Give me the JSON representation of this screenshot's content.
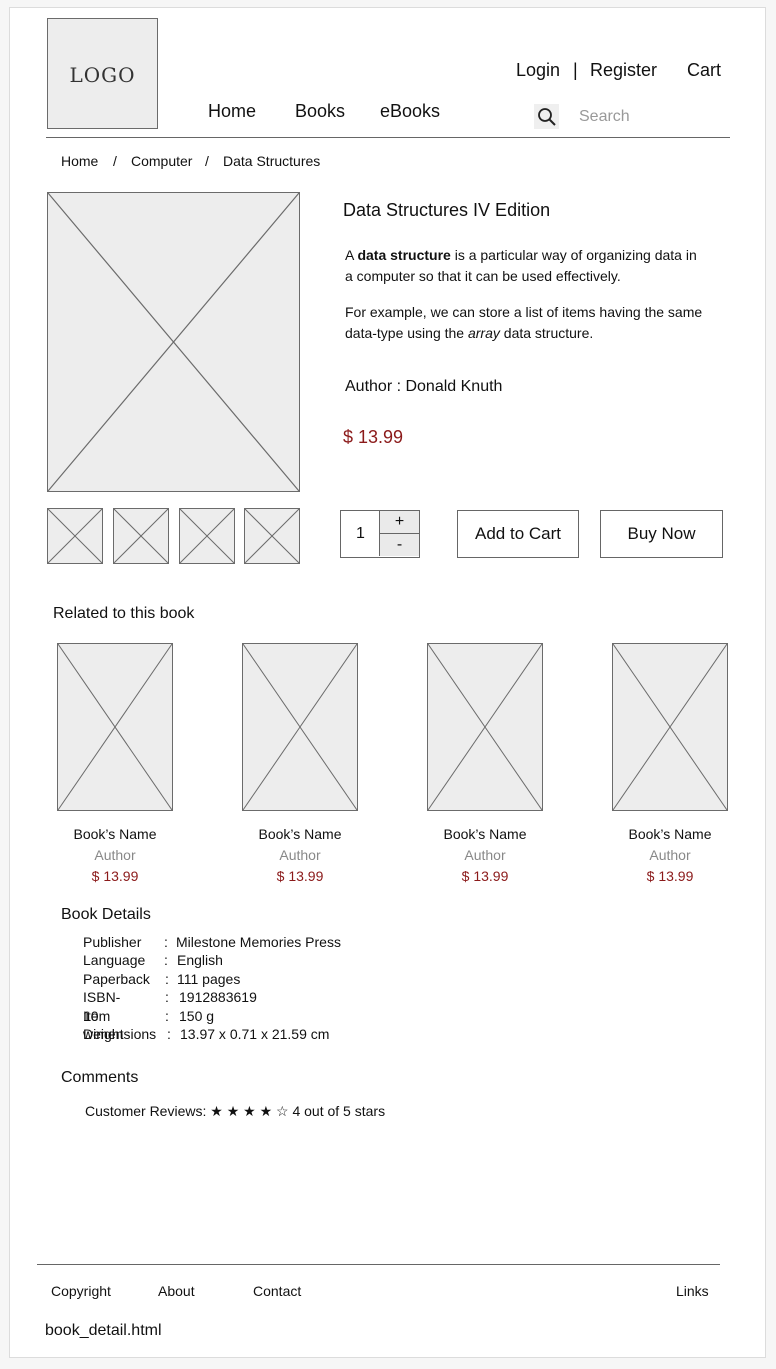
{
  "header": {
    "logo_text": "LOGO",
    "nav": [
      "Home",
      "Books",
      "eBooks"
    ],
    "login": "Login",
    "separator": "|",
    "register": "Register",
    "cart": "Cart",
    "search_placeholder": "Search"
  },
  "breadcrumb": {
    "items": [
      "Home",
      "Computer",
      "Data Structures"
    ],
    "separator": "/"
  },
  "product": {
    "title": "Data Structures IV Edition",
    "desc1_prefix": "A ",
    "desc1_bold": "data structure",
    "desc1_suffix": " is a particular way of organizing data in a computer so that it can be used effectively.",
    "desc2_prefix": "For example, we can store a list of items having the same data-type using the ",
    "desc2_italic": "array",
    "desc2_suffix": " data structure.",
    "author": "Author : Donald Knuth",
    "price": "$ 13.99",
    "quantity": "1",
    "plus": "+",
    "minus": "-",
    "add_to_cart": "Add to Cart",
    "buy_now": "Buy Now"
  },
  "related": {
    "title": "Related to this book",
    "items": [
      {
        "name": "Book’s Name",
        "author": "Author",
        "price": "$ 13.99"
      },
      {
        "name": "Book’s Name",
        "author": "Author",
        "price": "$ 13.99"
      },
      {
        "name": "Book’s Name",
        "author": "Author",
        "price": "$ 13.99"
      },
      {
        "name": "Book’s Name",
        "author": "Author",
        "price": "$ 13.99"
      }
    ]
  },
  "details": {
    "title": "Book Details",
    "rows": [
      {
        "label": "Publisher",
        "sep": ":",
        "value": "Milestone Memories Press"
      },
      {
        "label": "Language",
        "sep": ":",
        "value": "English"
      },
      {
        "label": "Paperback",
        "sep": ":",
        "value": "111 pages"
      },
      {
        "label": "ISBN-10",
        "sep": ":",
        "value": "1912883619"
      },
      {
        "label": "Item weight",
        "sep": ":",
        "value": "150 g"
      },
      {
        "label": "Dimensions",
        "sep": ":",
        "value": "13.97 x 0.71 x 21.59 cm"
      }
    ]
  },
  "comments": {
    "title": "Comments",
    "reviews_label": "Customer Reviews:",
    "rating": 4,
    "rating_max": 5,
    "stars": "★ ★ ★ ★ ☆",
    "rating_text": "4 out of 5 stars"
  },
  "footer": {
    "copyright": "Copyright",
    "about": "About",
    "contact": "Contact",
    "links": "Links"
  },
  "filename": "book_detail.html",
  "colors": {
    "price": "#8b1a1a",
    "placeholder_fill": "#ededed",
    "stroke": "#6b6b6b"
  }
}
